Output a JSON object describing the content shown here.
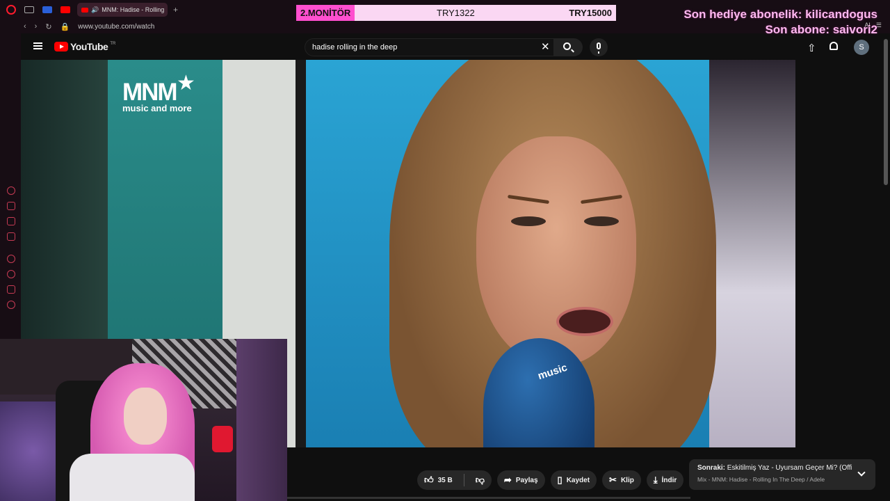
{
  "browser": {
    "tab_title": "MNM: Hadise - Rolling",
    "url": "www.youtube.com/watch",
    "addr_right": "AI"
  },
  "overlay": {
    "monitor_title": "2.MONİTÖR",
    "monitor_value1": "TRY1322",
    "monitor_value2": "TRY15000",
    "last_gift": "Son hediye abonelik: kilicandogus",
    "last_sub": "Son abone: saivori2"
  },
  "youtube": {
    "logo_text": "YouTube",
    "region": "TR",
    "search_value": "hadise rolling in the deep",
    "avatar_letter": "S"
  },
  "video": {
    "logo_main": "MNM",
    "logo_sub": "music and more",
    "mic_label": "music"
  },
  "actions": {
    "like_count": "35 B",
    "share": "Paylaş",
    "save": "Kaydet",
    "clip": "Klip",
    "download": "İndir"
  },
  "next_card": {
    "label": "Sonraki:",
    "title": "Eskitilmiş Yaz - Uyursam Geçer Mi? (Offici...",
    "subtitle": "Mix - MNM: Hadise - Rolling In The Deep / Adele"
  },
  "colors": {
    "youtube_red": "#ff0000",
    "overlay_pink": "#ff4fcf",
    "overlay_text": "#ffb8f0"
  }
}
